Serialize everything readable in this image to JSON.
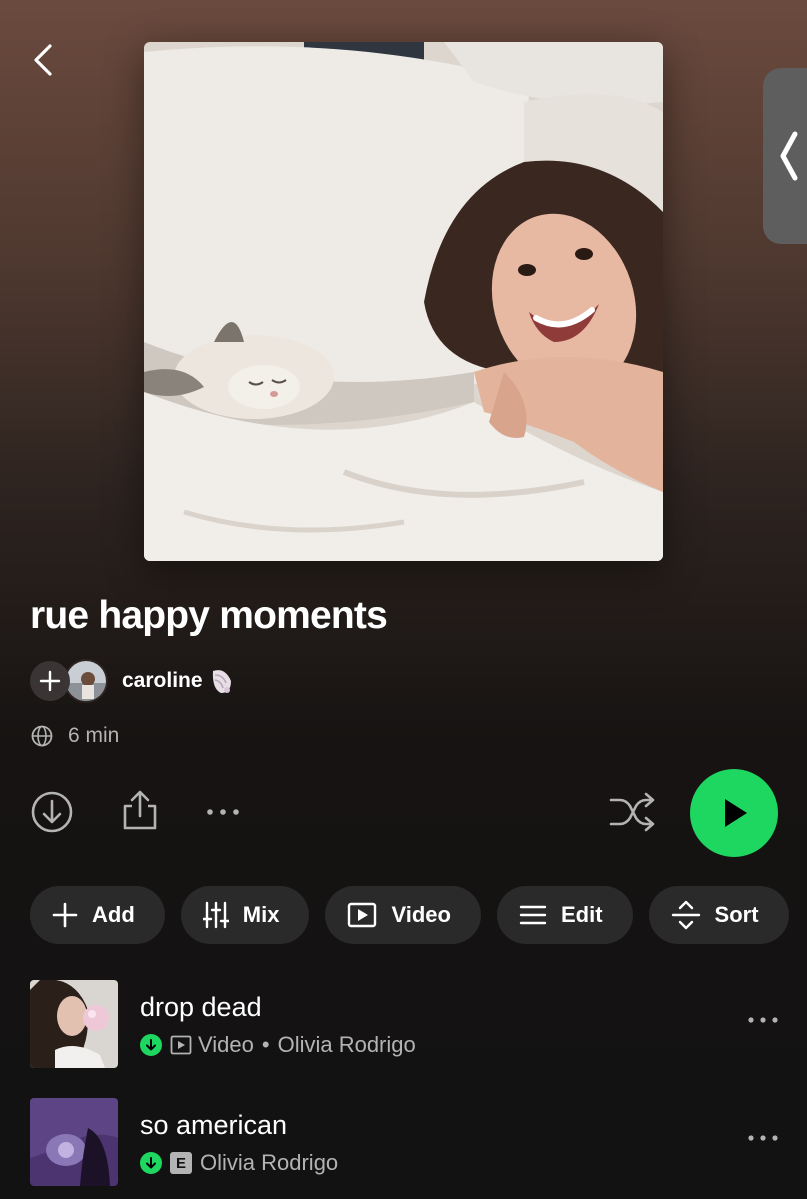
{
  "playlist": {
    "title": "rue happy moments",
    "owner": "caroline",
    "duration": "6 min"
  },
  "chips": [
    {
      "label": "Add",
      "icon": "plus-icon"
    },
    {
      "label": "Mix",
      "icon": "sliders-icon"
    },
    {
      "label": "Video",
      "icon": "video-icon"
    },
    {
      "label": "Edit",
      "icon": "list-icon"
    },
    {
      "label": "Sort",
      "icon": "sort-icon"
    }
  ],
  "tracks": [
    {
      "title": "drop dead",
      "type": "Video",
      "separator": "•",
      "artist": "Olivia Rodrigo",
      "downloaded": true,
      "explicit": false
    },
    {
      "title": "so american",
      "badge": "E",
      "artist": "Olivia Rodrigo",
      "downloaded": true,
      "explicit": true
    }
  ],
  "colors": {
    "accent": "#1ed760",
    "chip_bg": "#2a2a2a",
    "subtext": "#b3b3b3"
  }
}
